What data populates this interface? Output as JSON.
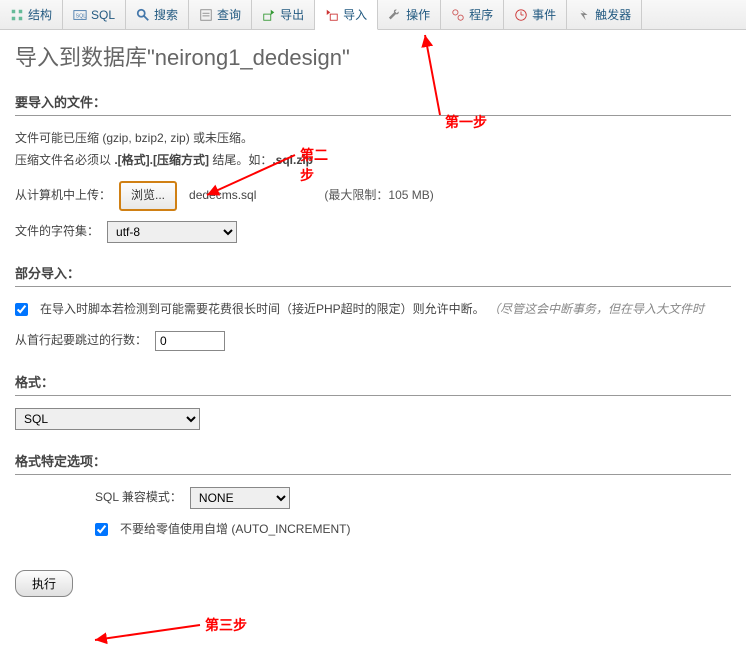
{
  "tabs": [
    {
      "label": "结构",
      "name": "tab-structure"
    },
    {
      "label": "SQL",
      "name": "tab-sql"
    },
    {
      "label": "搜索",
      "name": "tab-search"
    },
    {
      "label": "查询",
      "name": "tab-query"
    },
    {
      "label": "导出",
      "name": "tab-export"
    },
    {
      "label": "导入",
      "name": "tab-import",
      "active": true
    },
    {
      "label": "操作",
      "name": "tab-operations"
    },
    {
      "label": "程序",
      "name": "tab-routines"
    },
    {
      "label": "事件",
      "name": "tab-events"
    },
    {
      "label": "触发器",
      "name": "tab-triggers"
    }
  ],
  "page_title": "导入到数据库\"neirong1_dedesign\"",
  "sections": {
    "file": {
      "header": "要导入的文件：",
      "hint1": "文件可能已压缩 (gzip, bzip2, zip) 或未压缩。",
      "hint2_prefix": "压缩文件名必须以 ",
      "hint2_bold": ".[格式].[压缩方式]",
      "hint2_mid": " 结尾。如：",
      "hint2_bold2": ".sql.zip",
      "upload_label": "从计算机中上传：",
      "browse_btn": "浏览...",
      "filename": "dedecms.sql",
      "limit": "(最大限制：105 MB)",
      "charset_label": "文件的字符集：",
      "charset_value": "utf-8"
    },
    "partial": {
      "header": "部分导入：",
      "checkbox_label_main": "在导入时脚本若检测到可能需要花费很长时间（接近PHP超时的限定）则允许中断。",
      "checkbox_label_faded": "（尽管这会中断事务，但在导入大文件时",
      "skip_label": "从首行起要跳过的行数：",
      "skip_value": "0"
    },
    "format": {
      "header": "格式：",
      "value": "SQL"
    },
    "options": {
      "header": "格式特定选项：",
      "compat_label": "SQL 兼容模式：",
      "compat_value": "NONE",
      "ai_label": "不要给零值使用自增 (AUTO_INCREMENT)"
    }
  },
  "submit_btn": "执行",
  "annotations": {
    "step1": "第一步",
    "step2": "第二步",
    "step3": "第三步"
  }
}
